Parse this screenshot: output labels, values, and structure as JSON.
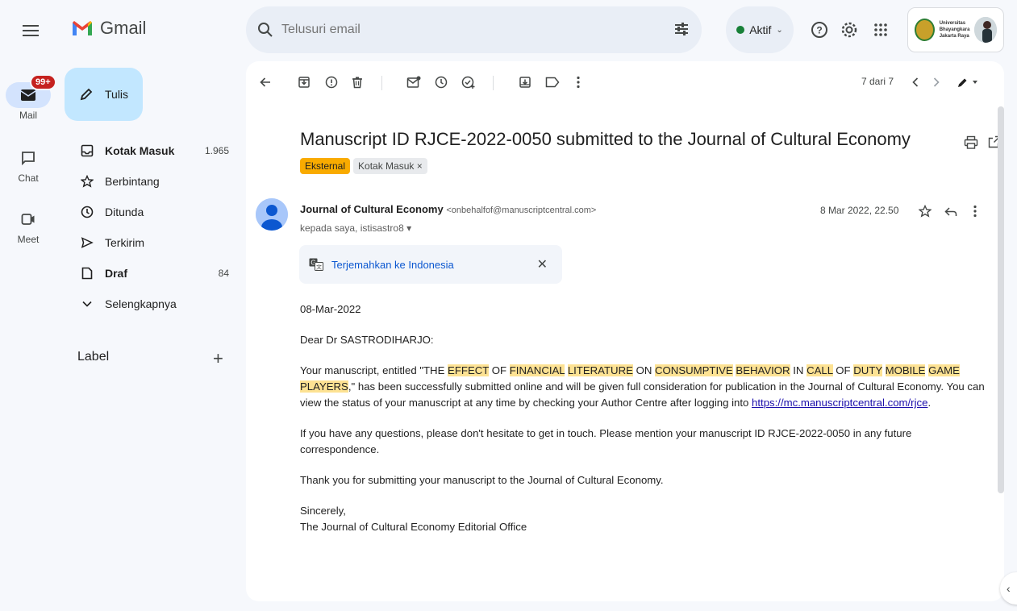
{
  "app": {
    "name": "Gmail"
  },
  "search": {
    "placeholder": "Telusuri email"
  },
  "status": {
    "label": "Aktif"
  },
  "account": {
    "org_text": "Universitas Bhayangkara Jakarta Raya"
  },
  "rail": {
    "mail_label": "Mail",
    "mail_badge": "99+",
    "chat_label": "Chat",
    "meet_label": "Meet"
  },
  "compose": {
    "label": "Tulis"
  },
  "nav": {
    "items": [
      {
        "label": "Kotak Masuk",
        "count": "1.965"
      },
      {
        "label": "Berbintang",
        "count": ""
      },
      {
        "label": "Ditunda",
        "count": ""
      },
      {
        "label": "Terkirim",
        "count": ""
      },
      {
        "label": "Draf",
        "count": "84"
      },
      {
        "label": "Selengkapnya",
        "count": ""
      }
    ],
    "labels_heading": "Label"
  },
  "toolbar": {
    "pager": "7 dari 7"
  },
  "email": {
    "subject": "Manuscript ID RJCE-2022-0050 submitted to the Journal of Cultural Economy",
    "chips": {
      "external": "Eksternal",
      "inbox": "Kotak Masuk ×"
    },
    "sender_name": "Journal of Cultural Economy",
    "sender_email": "<onbehalfof@manuscriptcentral.com>",
    "recipients": "kepada saya, istisastro8 ▾",
    "date": "8 Mar 2022, 22.50",
    "translate_label": "Terjemahkan ke Indonesia",
    "body": {
      "date_line": "08-Mar-2022",
      "greeting": "Dear Dr SASTRODIHARJO:",
      "p1_a": "Your manuscript, entitled \"THE ",
      "w_effect": "EFFECT",
      "t_of1": " OF ",
      "w_financial": "FINANCIAL",
      "t_sp1": " ",
      "w_literature": "LITERATURE",
      "t_on": " ON ",
      "w_consumptive": "CONSUMPTIVE",
      "t_sp2": " ",
      "w_behavior": "BEHAVIOR",
      "t_in": " IN ",
      "w_call": "CALL",
      "t_of2": " OF ",
      "w_duty": "DUTY",
      "t_sp3": " ",
      "w_mobile": "MOBILE",
      "t_sp4": " ",
      "w_game": "GAME",
      "t_sp5": " ",
      "w_players": "PLAYERS",
      "p1_b": ",\" has been successfully submitted online and will be given full consideration for publication in the Journal of Cultural Economy. You can view the status of your manuscript at any time by checking your Author Centre after logging into ",
      "link": "https://mc.manuscriptcentral.com/rjce",
      "p1_c": ".",
      "p2": "If you have any questions, please don't hesitate to get in touch. Please mention your manuscript ID RJCE-2022-0050 in any future correspondence.",
      "p3": "Thank you for submitting your manuscript to the Journal of Cultural Economy.",
      "closing": "Sincerely,",
      "signature": "The Journal of Cultural Economy Editorial Office"
    }
  }
}
